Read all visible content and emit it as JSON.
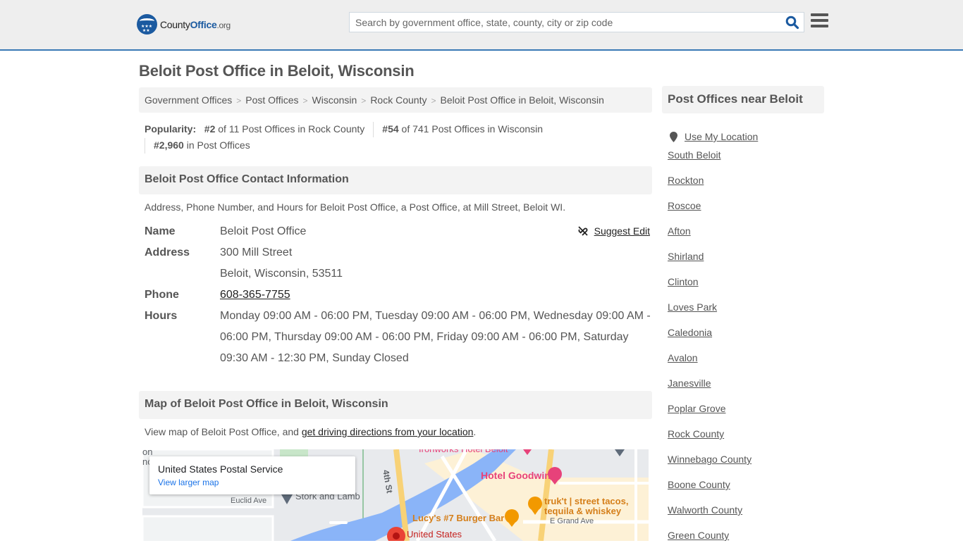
{
  "header": {
    "logo": {
      "prefix": "County",
      "brand": "Office",
      "tld": ".org"
    },
    "search_placeholder": "Search by government office, state, county, city or zip code",
    "search_value": "",
    "accent_color": "#1b5aa0"
  },
  "page": {
    "title": "Beloit Post Office in Beloit, Wisconsin"
  },
  "breadcrumb": [
    {
      "label": "Government Offices"
    },
    {
      "label": "Post Offices"
    },
    {
      "label": "Wisconsin"
    },
    {
      "label": "Rock County"
    },
    {
      "label": "Beloit Post Office in Beloit, Wisconsin"
    }
  ],
  "popularity": {
    "label": "Popularity:",
    "county_rank": "#2",
    "county_text": "of 11 Post Offices in Rock County",
    "state_rank": "#54",
    "state_text": "of 741 Post Offices in Wisconsin",
    "national_rank": "#2,960",
    "national_text": "in Post Offices"
  },
  "contact": {
    "heading": "Beloit Post Office Contact Information",
    "description": "Address, Phone Number, and Hours for Beloit Post Office, a Post Office, at Mill Street, Beloit WI.",
    "suggest_edit": "Suggest Edit",
    "name_label": "Name",
    "name": "Beloit Post Office",
    "address_label": "Address",
    "address_line1": "300 Mill Street",
    "address_line2": "Beloit, Wisconsin, 53511",
    "phone_label": "Phone",
    "phone": "608-365-7755",
    "hours_label": "Hours",
    "hours": "Monday 09:00 AM - 06:00 PM, Tuesday 09:00 AM - 06:00 PM, Wednesday 09:00 AM - 06:00 PM, Thursday 09:00 AM - 06:00 PM, Friday 09:00 AM - 06:00 PM, Saturday 09:30 AM - 12:30 PM, Sunday Closed"
  },
  "map_section": {
    "heading": "Map of Beloit Post Office in Beloit, Wisconsin",
    "desc_prefix": "View map of Beloit Post Office, and ",
    "desc_link": "get driving directions from your location",
    "desc_suffix": ".",
    "card_title": "United States Postal Service",
    "card_link": "View larger map",
    "labels": {
      "euclid": "Euclid Ave",
      "stork": "Stork and Lamb",
      "fourth": "4th St",
      "ironworks": "Ironworks Hotel Beloit",
      "goodwin": "Hotel Goodwin",
      "trukt1": "truk't | street tacos,",
      "trukt2": "tequila & whiskey",
      "lucys": "Lucy's #7 Burger Bar",
      "grand": "E Grand Ave",
      "usps": "United States",
      "edge1": "on",
      "edge2": "nc"
    }
  },
  "sidebar": {
    "heading": "Post Offices near Beloit",
    "use_location": "Use My Location",
    "items": [
      "South Beloit",
      "Rockton",
      "Roscoe",
      "Afton",
      "Shirland",
      "Clinton",
      "Loves Park",
      "Caledonia",
      "Avalon",
      "Janesville",
      "Poplar Grove",
      "Rock County",
      "Winnebago County",
      "Boone County",
      "Walworth County",
      "Green County"
    ]
  }
}
